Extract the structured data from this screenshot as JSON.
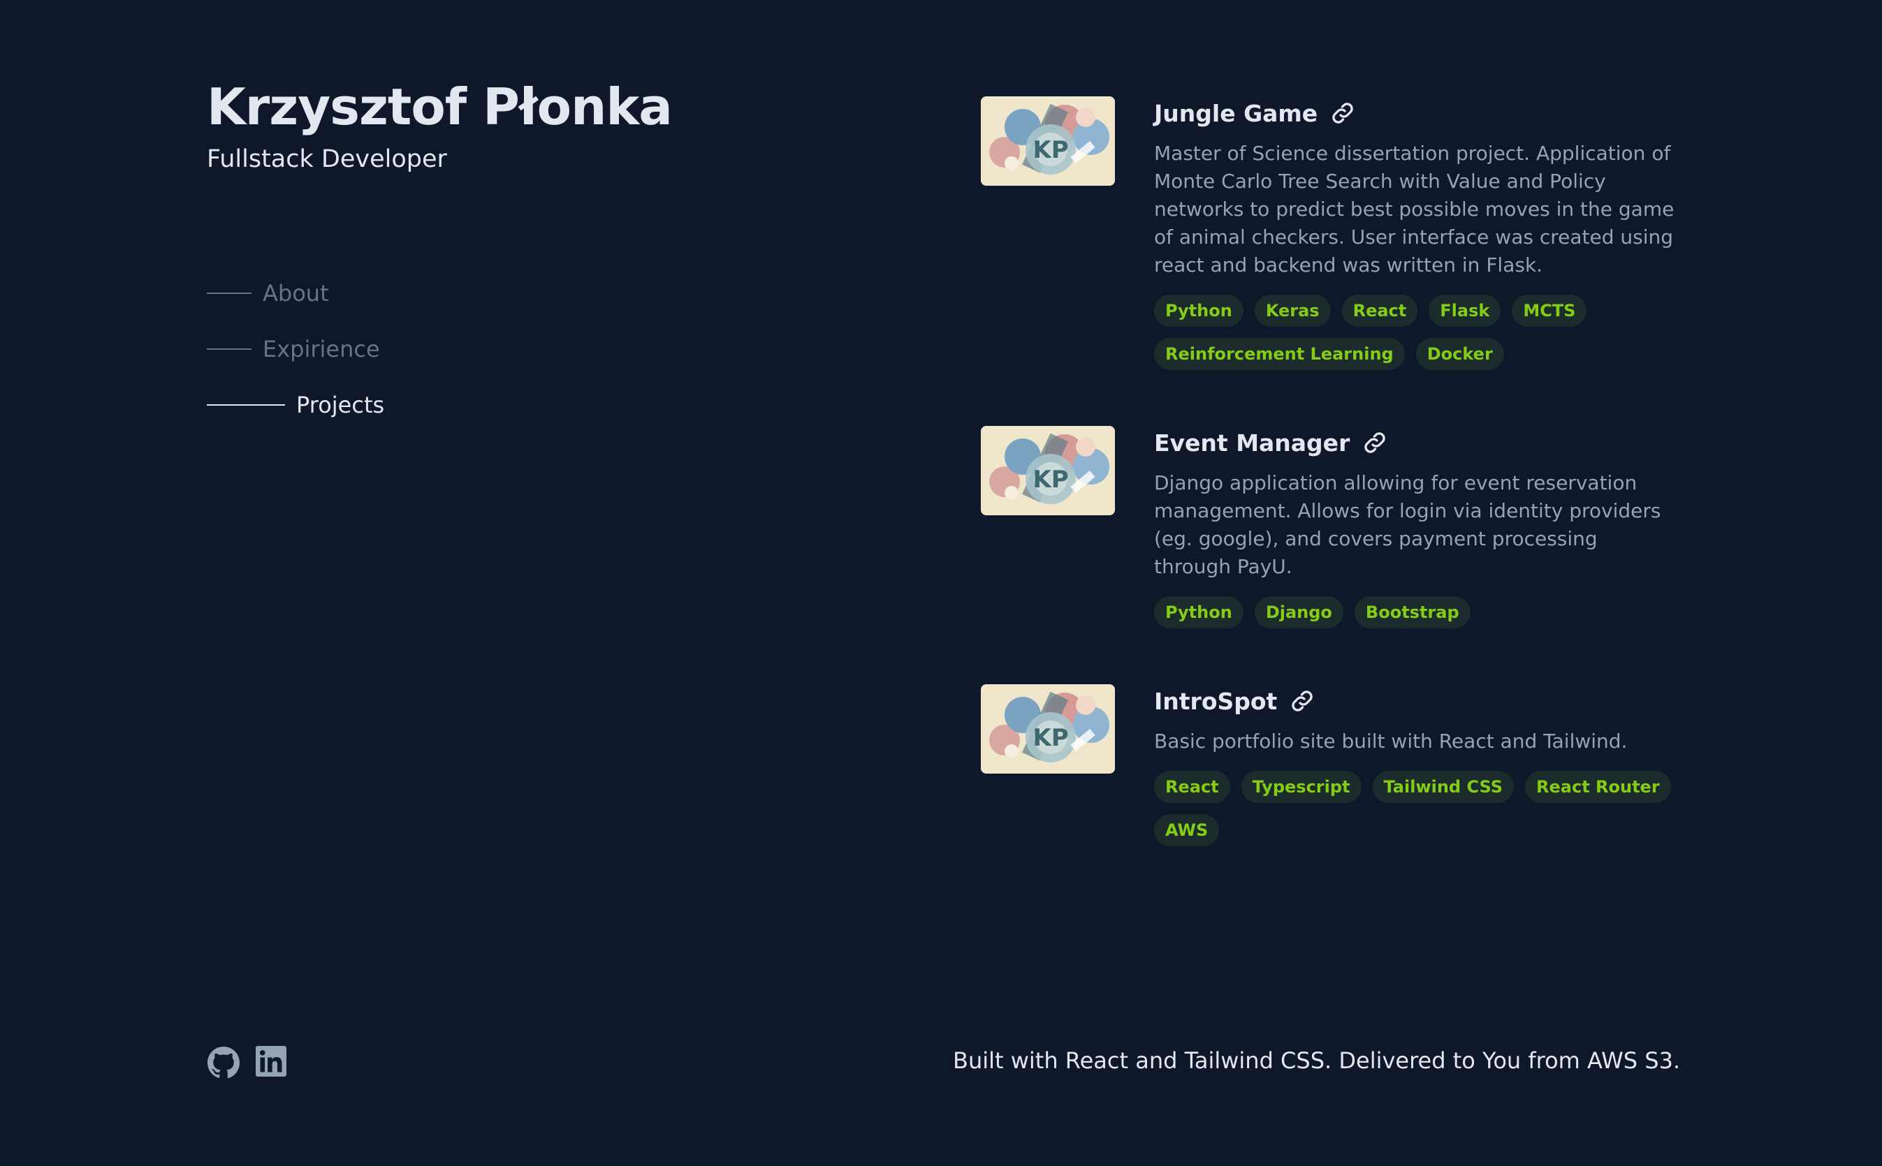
{
  "header": {
    "name": "Krzysztof Płonka",
    "role": "Fullstack Developer"
  },
  "nav": {
    "items": [
      {
        "label": "About",
        "active": false
      },
      {
        "label": "Expirience",
        "active": false
      },
      {
        "label": "Projects",
        "active": true
      }
    ]
  },
  "projects": [
    {
      "title": "Jungle Game",
      "description": "Master of Science dissertation project. Application of Monte Carlo Tree Search with Value and Policy networks to predict best possible moves in the game of animal checkers. User interface was created using react and backend was written in Flask.",
      "thumbnail_text": "KP",
      "tags": [
        "Python",
        "Keras",
        "React",
        "Flask",
        "MCTS",
        "Reinforcement Learning",
        "Docker"
      ]
    },
    {
      "title": "Event Manager",
      "description": "Django application allowing for event reservation management. Allows for login via identity providers (eg. google), and covers payment processing through PayU.",
      "thumbnail_text": "KP",
      "tags": [
        "Python",
        "Django",
        "Bootstrap"
      ]
    },
    {
      "title": "IntroSpot",
      "description": "Basic portfolio site built with React and Tailwind.",
      "thumbnail_text": "KP",
      "tags": [
        "React",
        "Typescript",
        "Tailwind CSS",
        "React Router",
        "AWS"
      ]
    }
  ],
  "footer": {
    "icons": [
      "github-icon",
      "linkedin-icon"
    ],
    "text": "Built with React and Tailwind CSS. Delivered to You from AWS S3."
  },
  "colors": {
    "background": "#0f172a",
    "heading": "#e2e8f0",
    "body": "#94a3b8",
    "muted": "#64748b",
    "tag_text": "#84cc16",
    "tag_bg": "#1c2b2c"
  }
}
